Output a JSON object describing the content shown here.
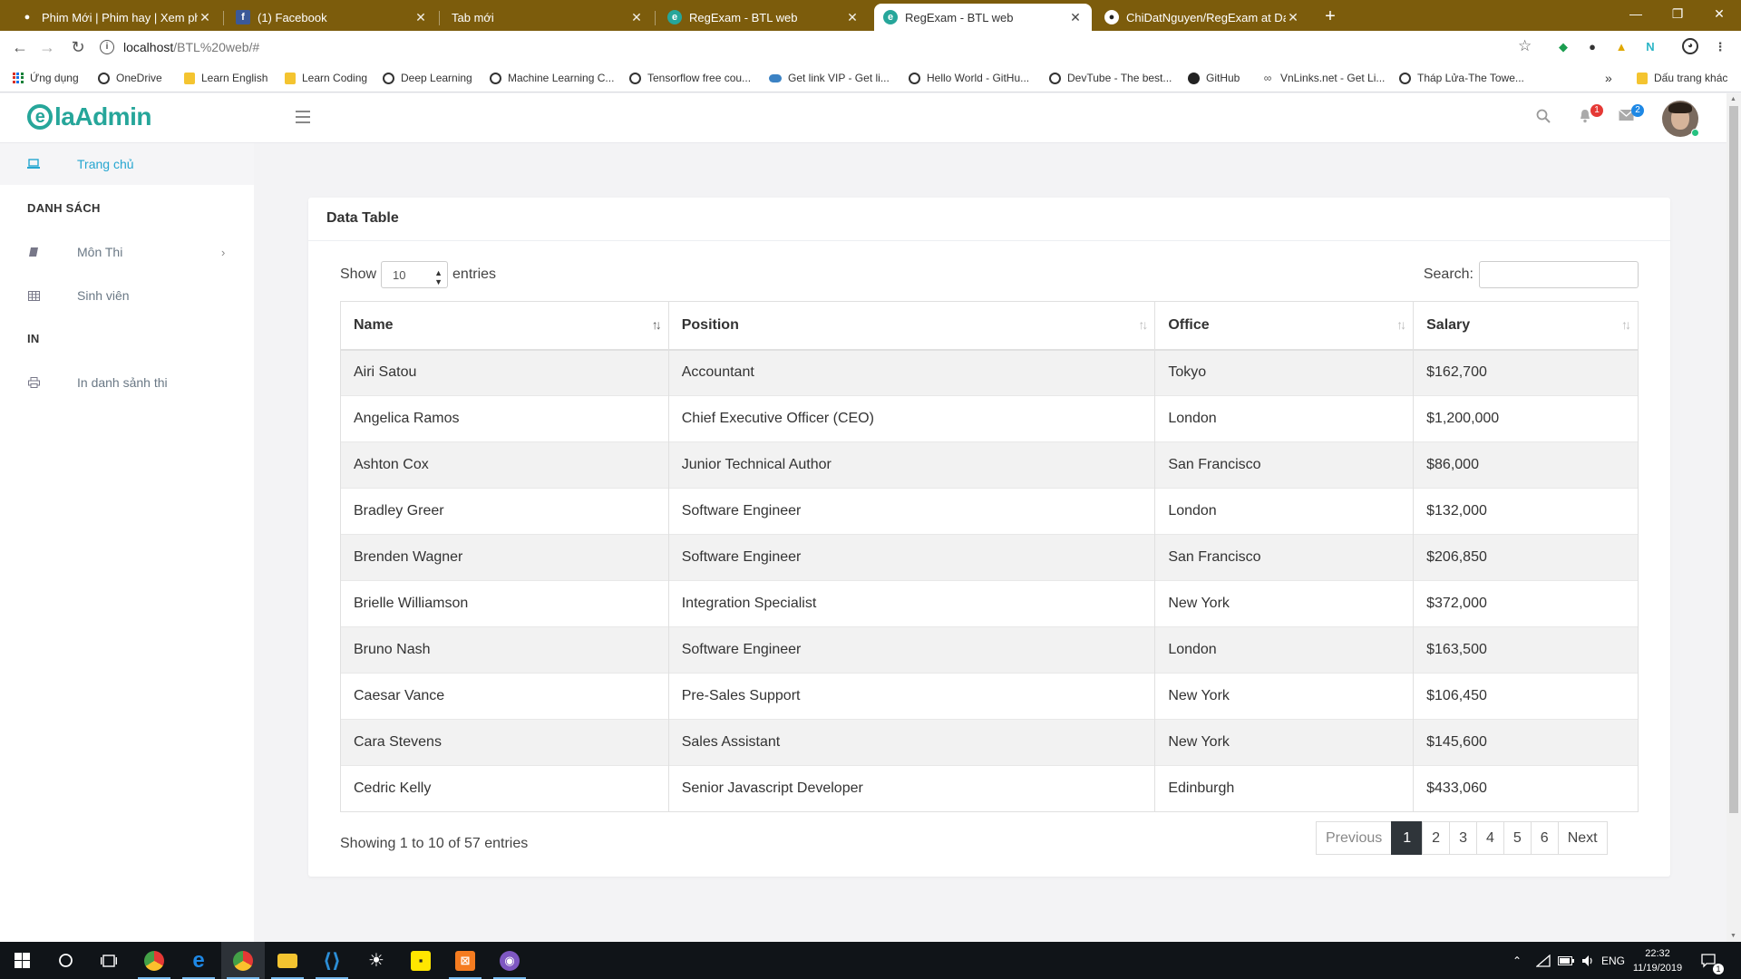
{
  "browser": {
    "tabs": [
      {
        "title": "Phim Mới | Phim hay | Xem phim",
        "close": "✕"
      },
      {
        "title": "(1) Facebook",
        "close": "✕"
      },
      {
        "title": "Tab mới",
        "close": "✕"
      },
      {
        "title": "RegExam - BTL web",
        "close": "✕"
      },
      {
        "title": "RegExam - BTL web",
        "close": "✕"
      },
      {
        "title": "ChiDatNguyen/RegExam at Dat's",
        "close": "✕"
      }
    ],
    "new_tab": "+",
    "window_controls": {
      "minimize": "—",
      "restore": "❐",
      "close": "✕"
    },
    "url_host": "localhost",
    "url_path": "/BTL%20web/#",
    "bookmarks": [
      "Ứng dụng",
      "OneDrive",
      "Learn English",
      "Learn Coding",
      "Deep Learning",
      "Machine Learning C...",
      "Tensorflow free cou...",
      "Get link VIP - Get li...",
      "Hello World - GitHu...",
      "DevTube - The best...",
      "GitHub",
      "VnLinks.net - Get Li...",
      "Tháp Lửa-The Towe..."
    ],
    "bookmarks_overflow": "»",
    "other_bookmarks": "Dấu trang khác"
  },
  "app": {
    "logo": {
      "mark": "e",
      "text": "laAdmin"
    },
    "notifications_count": "1",
    "messages_count": "2",
    "colors": {
      "accent": "#26a6d0",
      "brand": "#26a69a",
      "badge_red": "#e53935",
      "badge_blue": "#1e88e5"
    }
  },
  "sidebar": {
    "home": "Trang chủ",
    "section_list": "DANH SÁCH",
    "subjects": "Môn Thi",
    "students": "Sinh viên",
    "section_print": "IN",
    "print_list": "In danh sảnh thi"
  },
  "card": {
    "title": "Data Table",
    "show_label": "Show",
    "entries_label": "entries",
    "page_length": "10",
    "search_label": "Search:",
    "search_value": "",
    "columns": [
      "Name",
      "Position",
      "Office",
      "Salary"
    ],
    "rows": [
      [
        "Airi Satou",
        "Accountant",
        "Tokyo",
        "$162,700"
      ],
      [
        "Angelica Ramos",
        "Chief Executive Officer (CEO)",
        "London",
        "$1,200,000"
      ],
      [
        "Ashton Cox",
        "Junior Technical Author",
        "San Francisco",
        "$86,000"
      ],
      [
        "Bradley Greer",
        "Software Engineer",
        "London",
        "$132,000"
      ],
      [
        "Brenden Wagner",
        "Software Engineer",
        "San Francisco",
        "$206,850"
      ],
      [
        "Brielle Williamson",
        "Integration Specialist",
        "New York",
        "$372,000"
      ],
      [
        "Bruno Nash",
        "Software Engineer",
        "London",
        "$163,500"
      ],
      [
        "Caesar Vance",
        "Pre-Sales Support",
        "New York",
        "$106,450"
      ],
      [
        "Cara Stevens",
        "Sales Assistant",
        "New York",
        "$145,600"
      ],
      [
        "Cedric Kelly",
        "Senior Javascript Developer",
        "Edinburgh",
        "$433,060"
      ]
    ],
    "info": "Showing 1 to 10 of 57 entries",
    "pager": {
      "previous": "Previous",
      "pages": [
        "1",
        "2",
        "3",
        "4",
        "5",
        "6"
      ],
      "current": "1",
      "next": "Next"
    }
  },
  "taskbar": {
    "language": "ENG",
    "time": "22:32",
    "date": "11/19/2019",
    "notification_count": "1"
  }
}
